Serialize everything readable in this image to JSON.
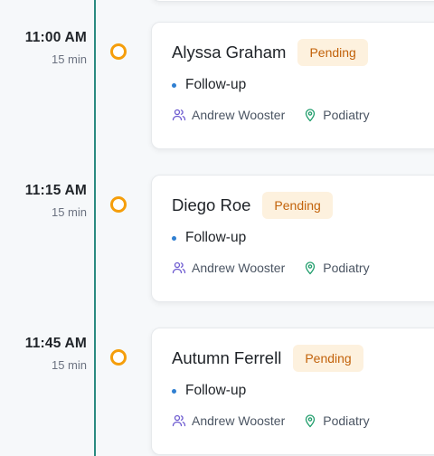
{
  "colors": {
    "rail": "#2a8a80",
    "dot": "#f59e0b",
    "badge_bg": "#fdf1de",
    "badge_text": "#c2620a",
    "visit_dot": "#2f7fd1",
    "provider_icon": "#6d5bd0",
    "location_icon": "#1f9d6b"
  },
  "appointments": [
    {
      "time": "11:00 AM",
      "duration": "15 min",
      "patient": "Alyssa Graham",
      "status": "Pending",
      "visit_type": "Follow-up",
      "provider": "Andrew Wooster",
      "department": "Podiatry",
      "provider_icon": "users-icon",
      "department_icon": "map-pin-icon"
    },
    {
      "time": "11:15 AM",
      "duration": "15 min",
      "patient": "Diego Roe",
      "status": "Pending",
      "visit_type": "Follow-up",
      "provider": "Andrew Wooster",
      "department": "Podiatry",
      "provider_icon": "users-icon",
      "department_icon": "map-pin-icon"
    },
    {
      "time": "11:45 AM",
      "duration": "15 min",
      "patient": "Autumn Ferrell",
      "status": "Pending",
      "visit_type": "Follow-up",
      "provider": "Andrew Wooster",
      "department": "Podiatry",
      "provider_icon": "users-icon",
      "department_icon": "map-pin-icon"
    }
  ]
}
